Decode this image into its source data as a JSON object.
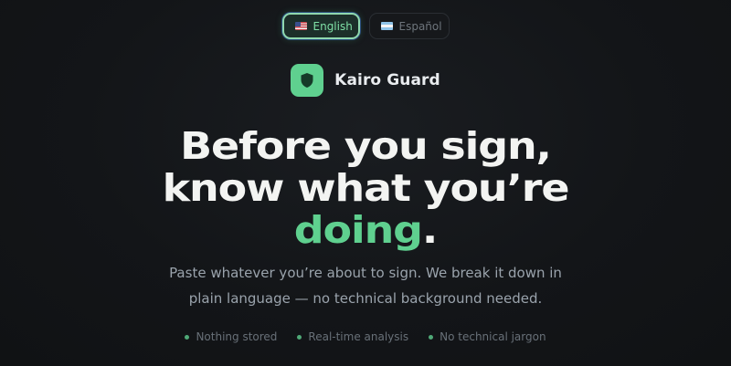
{
  "languages": [
    {
      "label": "English",
      "flag": "us-flag",
      "active": true
    },
    {
      "label": "Español",
      "flag": "argentina-flag",
      "active": false
    }
  ],
  "brand": {
    "name": "Kairo Guard",
    "icon": "shield-icon",
    "color": "#5fd08f"
  },
  "hero": {
    "line1": "Before you sign,",
    "line2": "know what you’re",
    "accent_word": "doing",
    "trailing": ".",
    "subtitle_line1": "Paste whatever you’re about to sign. We break it down in",
    "subtitle_line2": "plain language — no technical background needed."
  },
  "features": [
    "Nothing stored",
    "Real-time analysis",
    "No technical jargon"
  ],
  "colors": {
    "accent": "#5fd08f",
    "background": "#121417",
    "text": "#f3f4f2"
  }
}
